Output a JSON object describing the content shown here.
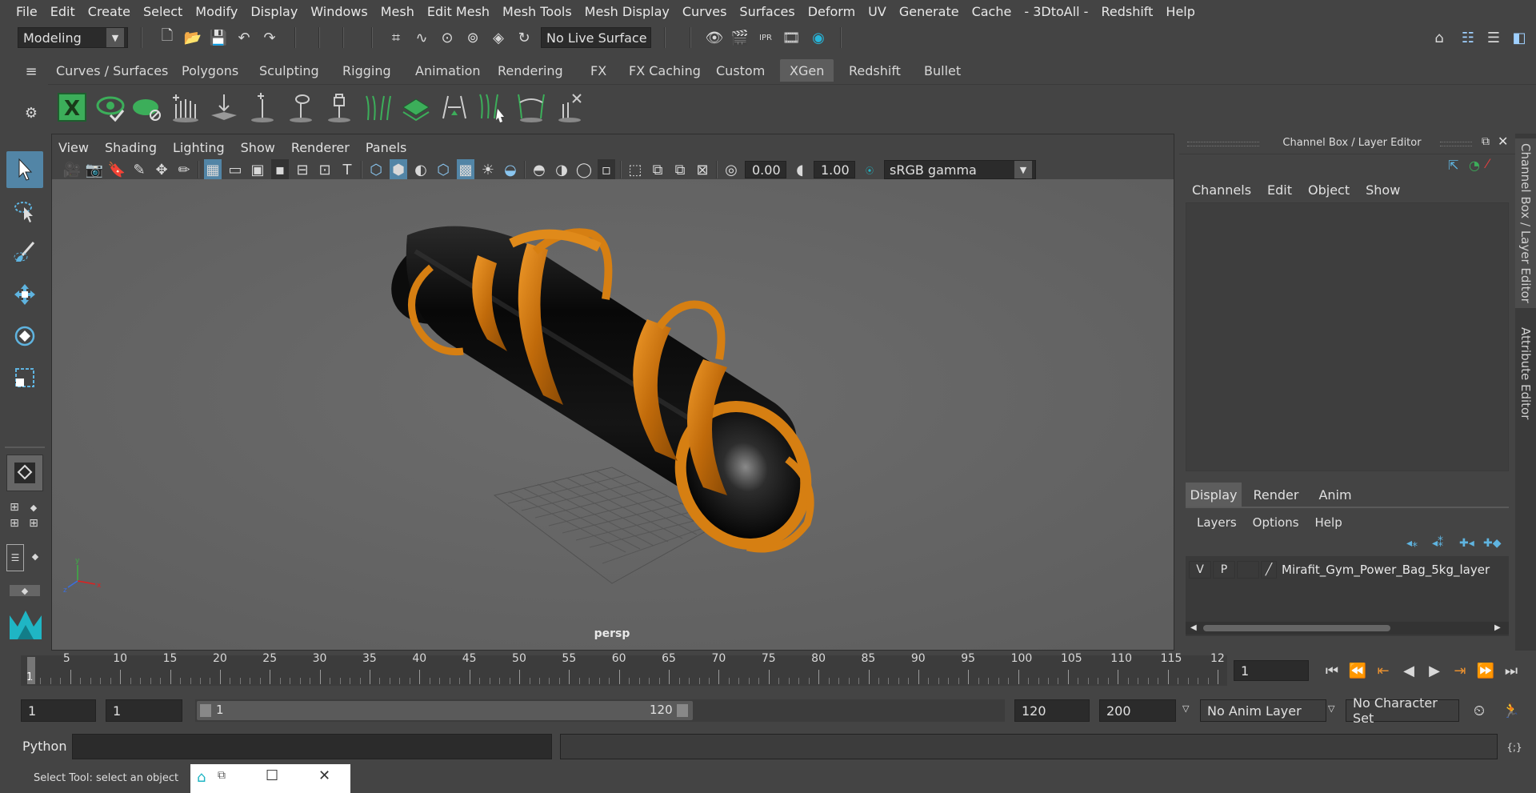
{
  "menubar": {
    "items": [
      "File",
      "Edit",
      "Create",
      "Select",
      "Modify",
      "Display",
      "Windows",
      "Mesh",
      "Edit Mesh",
      "Mesh Tools",
      "Mesh Display",
      "Curves",
      "Surfaces",
      "Deform",
      "UV",
      "Generate",
      "Cache",
      "- 3DtoAll -",
      "Redshift",
      "Help"
    ]
  },
  "statusline": {
    "mode": "Modeling",
    "live_surface": "No Live Surface"
  },
  "shelf": {
    "tabs": [
      "Curves / Surfaces",
      "Polygons",
      "Sculpting",
      "Rigging",
      "Animation",
      "Rendering",
      "FX",
      "FX Caching",
      "Custom",
      "XGen",
      "Redshift",
      "Bullet"
    ],
    "active_tab": "XGen"
  },
  "viewport": {
    "menu": [
      "View",
      "Shading",
      "Lighting",
      "Show",
      "Renderer",
      "Panels"
    ],
    "exposure": "0.00",
    "gamma": "1.00",
    "color_space": "sRGB gamma",
    "camera_label": "persp",
    "object": "Mirafit Gym Power Bag 5kg"
  },
  "channelbox": {
    "title": "Channel Box / Layer Editor",
    "menu": [
      "Channels",
      "Edit",
      "Object",
      "Show"
    ],
    "layer_tabs": [
      "Display",
      "Render",
      "Anim"
    ],
    "active_layer_tab": "Display",
    "layer_menu": [
      "Layers",
      "Options",
      "Help"
    ],
    "layer": {
      "v": "V",
      "p": "P",
      "name": "Mirafit_Gym_Power_Bag_5kg_layer"
    }
  },
  "side_tabs": [
    "Channel Box / Layer Editor",
    "Attribute Editor"
  ],
  "timeline": {
    "ticks": [
      "5",
      "10",
      "15",
      "20",
      "25",
      "30",
      "35",
      "40",
      "45",
      "50",
      "55",
      "60",
      "65",
      "70",
      "75",
      "80",
      "85",
      "90",
      "95",
      "100",
      "105",
      "110",
      "115",
      "12"
    ],
    "current_frame_marker": "1",
    "current_frame": "1"
  },
  "range": {
    "start": "1",
    "anim_start": "1",
    "slider_start": "1",
    "slider_end": "120",
    "end": "120",
    "anim_end": "200",
    "anim_layer": "No Anim Layer",
    "character_set": "No Character Set"
  },
  "cmdline": {
    "lang": "Python"
  },
  "helpline": {
    "text": "Select Tool: select an object"
  },
  "colors": {
    "bag_orange": "#d67f12",
    "bag_black": "#0c0c0c",
    "accent_blue": "#5285a6",
    "maya_teal": "#1fb5c4",
    "xgen_green": "#3cae5a"
  }
}
